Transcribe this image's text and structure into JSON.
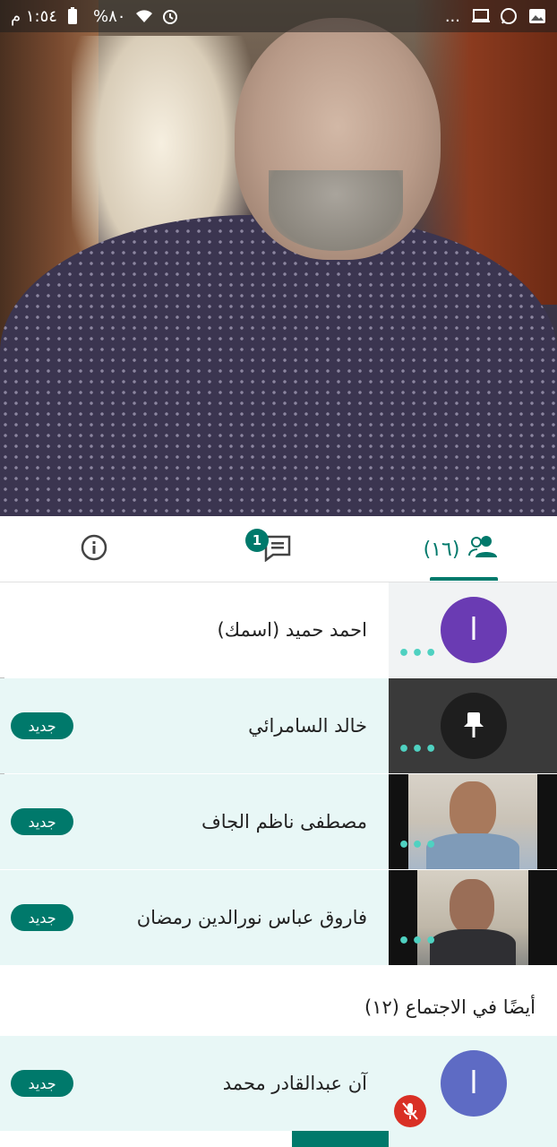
{
  "status_bar": {
    "time": "١:٥٤ م",
    "battery": "%٨٠",
    "overflow": "..."
  },
  "tabs": {
    "info_icon": "info-icon",
    "chat_icon": "chat-icon",
    "chat_badge": "1",
    "people_icon": "people-icon",
    "people_count": "(١٦)"
  },
  "participants": [
    {
      "name": "احمد حميد (اسمك)",
      "avatar_letter": "ا",
      "avatar_color": "#6a3bb3",
      "badge": ""
    },
    {
      "name": "خالد السامرائي",
      "badge": "جديد"
    },
    {
      "name": "مصطفى ناظم الجاف",
      "badge": "جديد"
    },
    {
      "name": "فاروق عباس نورالدين رمضان",
      "badge": "جديد"
    }
  ],
  "also_in_meeting": {
    "title": "أيضًا في الاجتماع (١٢)",
    "participants": [
      {
        "name": "آن عبدالقادر محمد",
        "avatar_letter": "ا",
        "avatar_color": "#5e6bc4",
        "badge": "جديد"
      }
    ]
  },
  "colors": {
    "accent": "#00796b",
    "row_highlight": "#e8f7f6",
    "mute_red": "#d93025",
    "dots": "#4fd1c1"
  }
}
